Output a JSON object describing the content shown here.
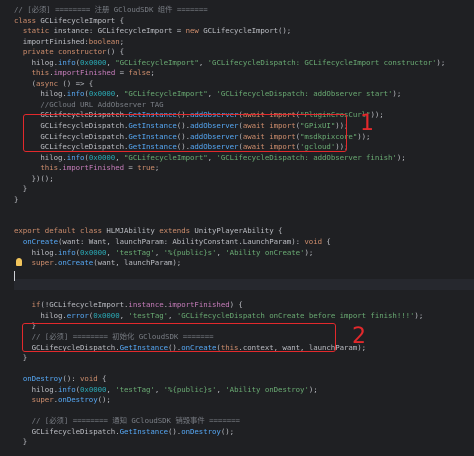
{
  "editor": {
    "annotations": [
      {
        "label": "1",
        "color": "#e2292c"
      },
      {
        "label": "2",
        "color": "#e2292c"
      }
    ],
    "lines": [
      [
        {
          "t": "// [必须] ======== 注册 GCloudSDK 组件 =======",
          "c": "cm"
        }
      ],
      [
        {
          "t": "class ",
          "c": "kw"
        },
        {
          "t": "GCLifecycleImport {"
        }
      ],
      [
        {
          "t": "  "
        },
        {
          "t": "static ",
          "c": "kw"
        },
        {
          "t": "instance"
        },
        {
          "t": ": GCLifecycleImport = "
        },
        {
          "t": "new ",
          "c": "kw"
        },
        {
          "t": "GCLifecycleImport();"
        }
      ],
      [
        {
          "t": "  importFinished:"
        },
        {
          "t": "boolean",
          "c": "kw"
        },
        {
          "t": ";"
        }
      ],
      [
        {
          "t": "  "
        },
        {
          "t": "private ",
          "c": "kw"
        },
        {
          "t": "constructor",
          "c": "kw"
        },
        {
          "t": "() {"
        }
      ],
      [
        {
          "t": "    hilog."
        },
        {
          "t": "info",
          "c": "fn"
        },
        {
          "t": "("
        },
        {
          "t": "0x0000",
          "c": "num"
        },
        {
          "t": ", "
        },
        {
          "t": "\"GCLifecycleImport\"",
          "c": "str"
        },
        {
          "t": ", "
        },
        {
          "t": "'GCLifecycleDispatch: GCLifecycleImport constructor'",
          "c": "str"
        },
        {
          "t": ");"
        }
      ],
      [
        {
          "t": "    "
        },
        {
          "t": "this",
          "c": "kw"
        },
        {
          "t": "."
        },
        {
          "t": "importFinished",
          "c": "fld"
        },
        {
          "t": " = "
        },
        {
          "t": "false",
          "c": "kw"
        },
        {
          "t": ";"
        }
      ],
      [
        {
          "t": "    ("
        },
        {
          "t": "async ",
          "c": "kw"
        },
        {
          "t": "() => {"
        }
      ],
      [
        {
          "t": "      hilog."
        },
        {
          "t": "info",
          "c": "fn"
        },
        {
          "t": "("
        },
        {
          "t": "0x0000",
          "c": "num"
        },
        {
          "t": ", "
        },
        {
          "t": "\"GCLifecycleImport\"",
          "c": "str"
        },
        {
          "t": ", "
        },
        {
          "t": "'GCLifecycleDispatch: addObserver start'",
          "c": "str"
        },
        {
          "t": ");"
        }
      ],
      [
        {
          "t": "      //GCloud URL AddObserver TAG",
          "c": "cm"
        }
      ],
      [
        {
          "t": "      GCLifecycleDispatch."
        },
        {
          "t": "GetInstance",
          "c": "fn"
        },
        {
          "t": "()."
        },
        {
          "t": "addObserver",
          "c": "fn"
        },
        {
          "t": "("
        },
        {
          "t": "await ",
          "c": "kw"
        },
        {
          "t": "import",
          "c": "kw"
        },
        {
          "t": "("
        },
        {
          "t": "\"PluginCrosCurl\"",
          "c": "str"
        },
        {
          "t": "));"
        }
      ],
      [
        {
          "t": "      GCLifecycleDispatch."
        },
        {
          "t": "GetInstance",
          "c": "fn"
        },
        {
          "t": "()."
        },
        {
          "t": "addObserver",
          "c": "fn"
        },
        {
          "t": "("
        },
        {
          "t": "await ",
          "c": "kw"
        },
        {
          "t": "import",
          "c": "kw"
        },
        {
          "t": "("
        },
        {
          "t": "\"GPixUI\"",
          "c": "str"
        },
        {
          "t": "));"
        }
      ],
      [
        {
          "t": "      GCLifecycleDispatch."
        },
        {
          "t": "GetInstance",
          "c": "fn"
        },
        {
          "t": "()."
        },
        {
          "t": "addObserver",
          "c": "fn"
        },
        {
          "t": "("
        },
        {
          "t": "await ",
          "c": "kw"
        },
        {
          "t": "import",
          "c": "kw"
        },
        {
          "t": "("
        },
        {
          "t": "\"msdkpixcore\"",
          "c": "str"
        },
        {
          "t": "));"
        }
      ],
      [
        {
          "t": "      GCLifecycleDispatch."
        },
        {
          "t": "GetInstance",
          "c": "fn"
        },
        {
          "t": "()."
        },
        {
          "t": "addObserver",
          "c": "fn"
        },
        {
          "t": "("
        },
        {
          "t": "await ",
          "c": "kw"
        },
        {
          "t": "import",
          "c": "kw"
        },
        {
          "t": "("
        },
        {
          "t": "'gcloud'",
          "c": "str"
        },
        {
          "t": "));"
        }
      ],
      [
        {
          "t": "      hilog."
        },
        {
          "t": "info",
          "c": "fn"
        },
        {
          "t": "("
        },
        {
          "t": "0x0000",
          "c": "num"
        },
        {
          "t": ", "
        },
        {
          "t": "\"GCLifecycleImport\"",
          "c": "str"
        },
        {
          "t": ", "
        },
        {
          "t": "'GCLifecycleDispatch: addObserver finish'",
          "c": "str"
        },
        {
          "t": ");"
        }
      ],
      [
        {
          "t": "      "
        },
        {
          "t": "this",
          "c": "kw"
        },
        {
          "t": "."
        },
        {
          "t": "importFinished",
          "c": "fld"
        },
        {
          "t": " = "
        },
        {
          "t": "true",
          "c": "kw"
        },
        {
          "t": ";"
        }
      ],
      [
        {
          "t": "    })();"
        }
      ],
      [
        {
          "t": "  }"
        }
      ],
      [
        {
          "t": "}"
        }
      ],
      [
        {
          "t": ""
        }
      ],
      [
        {
          "t": ""
        }
      ],
      [
        {
          "t": "export ",
          "c": "kw"
        },
        {
          "t": "default ",
          "c": "kw"
        },
        {
          "t": "class ",
          "c": "kw"
        },
        {
          "t": "HLMJAbility "
        },
        {
          "t": "extends ",
          "c": "kw"
        },
        {
          "t": "UnityPlayerAbility {"
        }
      ],
      [
        {
          "t": "  "
        },
        {
          "t": "onCreate",
          "c": "fn"
        },
        {
          "t": "(want: Want, launchParam: AbilityConstant.LaunchParam): "
        },
        {
          "t": "void",
          "c": "kw"
        },
        {
          "t": " {"
        }
      ],
      [
        {
          "t": "    hilog."
        },
        {
          "t": "info",
          "c": "fn"
        },
        {
          "t": "("
        },
        {
          "t": "0x0000",
          "c": "num"
        },
        {
          "t": ", "
        },
        {
          "t": "'testTag'",
          "c": "str"
        },
        {
          "t": ", "
        },
        {
          "t": "'%{public}s'",
          "c": "str"
        },
        {
          "t": ", "
        },
        {
          "t": "'Ability onCreate'",
          "c": "str"
        },
        {
          "t": ");"
        }
      ],
      [
        {
          "t": "    "
        },
        {
          "t": "super",
          "c": "kw"
        },
        {
          "t": "."
        },
        {
          "t": "onCreate",
          "c": "fn"
        },
        {
          "t": "(want, launchParam);"
        }
      ],
      [
        {
          "t": ""
        }
      ],
      [
        {
          "t": ""
        }
      ],
      [
        {
          "t": ""
        }
      ],
      [
        {
          "t": "    "
        },
        {
          "t": "if",
          "c": "kw"
        },
        {
          "t": "(!GCLifecycleImport."
        },
        {
          "t": "instance",
          "c": "fld"
        },
        {
          "t": "."
        },
        {
          "t": "importFinished",
          "c": "fld"
        },
        {
          "t": ") {"
        }
      ],
      [
        {
          "t": "      hilog."
        },
        {
          "t": "error",
          "c": "fn"
        },
        {
          "t": "("
        },
        {
          "t": "0x0000",
          "c": "num"
        },
        {
          "t": ", "
        },
        {
          "t": "'testTag'",
          "c": "str"
        },
        {
          "t": ", "
        },
        {
          "t": "'GCLifecycleDispatch onCreate before import finish!!!'",
          "c": "str"
        },
        {
          "t": ");"
        }
      ],
      [
        {
          "t": "    }"
        }
      ],
      [
        {
          "t": "    "
        },
        {
          "t": "// [必须] ======== 初始化 GCloudSDK =======",
          "c": "cm"
        }
      ],
      [
        {
          "t": "    GCLifecycleDispatch."
        },
        {
          "t": "GetInstance",
          "c": "fn"
        },
        {
          "t": "()."
        },
        {
          "t": "onCreate",
          "c": "fn"
        },
        {
          "t": "("
        },
        {
          "t": "this",
          "c": "kw"
        },
        {
          "t": ".context, want, launchParam);"
        }
      ],
      [
        {
          "t": "  }"
        }
      ],
      [
        {
          "t": ""
        }
      ],
      [
        {
          "t": "  "
        },
        {
          "t": "onDestroy",
          "c": "fn"
        },
        {
          "t": "(): "
        },
        {
          "t": "void",
          "c": "kw"
        },
        {
          "t": " {"
        }
      ],
      [
        {
          "t": "    hilog."
        },
        {
          "t": "info",
          "c": "fn"
        },
        {
          "t": "("
        },
        {
          "t": "0x0000",
          "c": "num"
        },
        {
          "t": ", "
        },
        {
          "t": "'testTag'",
          "c": "str"
        },
        {
          "t": ", "
        },
        {
          "t": "'%{public}s'",
          "c": "str"
        },
        {
          "t": ", "
        },
        {
          "t": "'Ability onDestroy'",
          "c": "str"
        },
        {
          "t": ");"
        }
      ],
      [
        {
          "t": "    "
        },
        {
          "t": "super",
          "c": "kw"
        },
        {
          "t": "."
        },
        {
          "t": "onDestroy",
          "c": "fn"
        },
        {
          "t": "();"
        }
      ],
      [
        {
          "t": ""
        }
      ],
      [
        {
          "t": "    "
        },
        {
          "t": "// [必须] ======== 通知 GCloudSDK 销毁事件 =======",
          "c": "cm"
        }
      ],
      [
        {
          "t": "    GCLifecycleDispatch."
        },
        {
          "t": "GetInstance",
          "c": "fn"
        },
        {
          "t": "()."
        },
        {
          "t": "onDestroy",
          "c": "fn"
        },
        {
          "t": "();"
        }
      ],
      [
        {
          "t": "  }"
        }
      ],
      [
        {
          "t": ""
        }
      ]
    ]
  }
}
